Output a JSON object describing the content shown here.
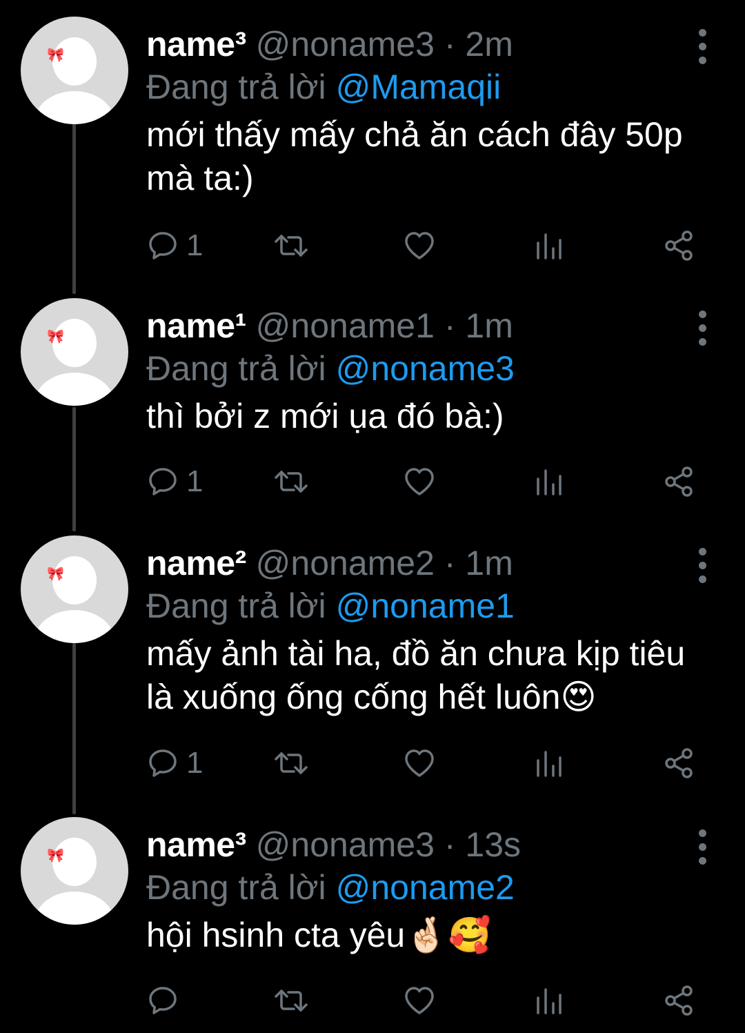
{
  "colors": {
    "background": "#000000",
    "text_primary": "#ffffff",
    "text_secondary": "#6e767d",
    "mention": "#1d9bf0",
    "thread_line": "#3d4044"
  },
  "icons": {
    "reply": "reply-icon",
    "retweet": "retweet-icon",
    "like": "heart-icon",
    "analytics": "analytics-icon",
    "share": "share-icon",
    "more": "more-vertical-icon"
  },
  "tweets": [
    {
      "display_name": "name³",
      "handle": "@noname3",
      "separator": "·",
      "time": "2m",
      "reply_prefix": "Đang trả lời",
      "reply_to": "@Mamaqii",
      "text": "mới thấy mấy chả ăn cách đây 50p mà ta:)",
      "reply_count": "1"
    },
    {
      "display_name": "name¹",
      "handle": "@noname1",
      "separator": "·",
      "time": "1m",
      "reply_prefix": "Đang trả lời",
      "reply_to": "@noname3",
      "text": "thì bởi z mới ụa đó bà:)",
      "reply_count": "1"
    },
    {
      "display_name": "name²",
      "handle": "@noname2",
      "separator": "·",
      "time": "1m",
      "reply_prefix": "Đang trả lời",
      "reply_to": "@noname1",
      "text": "mấy ảnh tài ha, đồ ăn chưa kịp tiêu là xuống ống cống hết luôn😍",
      "reply_count": "1"
    },
    {
      "display_name": "name³",
      "handle": "@noname3",
      "separator": "·",
      "time": "13s",
      "reply_prefix": "Đang trả lời",
      "reply_to": "@noname2",
      "text": "hội hsinh cta yêu🤞🏻🥰",
      "reply_count": ""
    }
  ]
}
